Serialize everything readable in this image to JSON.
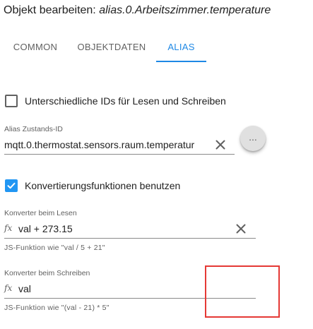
{
  "dialog": {
    "title_prefix": "Objekt bearbeiten: ",
    "object_id": "alias.0.Arbeitszimmer.temperature"
  },
  "tabs": [
    {
      "label": "COMMON",
      "active": false
    },
    {
      "label": "OBJEKTDATEN",
      "active": false
    },
    {
      "label": "ALIAS",
      "active": true
    }
  ],
  "alias": {
    "separate_ids": {
      "label": "Unterschiedliche IDs für Lesen und Schreiben",
      "checked": false
    },
    "state_id": {
      "label": "Alias Zustands-ID",
      "value": "mqtt.0.thermostat.sensors.raum.temperatur",
      "more_label": "..."
    },
    "use_conversion": {
      "label": "Konvertierungsfunktionen benutzen",
      "checked": true
    },
    "read_converter": {
      "label": "Konverter beim Lesen",
      "icon": "fx",
      "value": "val + 273.15",
      "helper": "JS-Funktion wie \"val / 5 + 21\""
    },
    "write_converter": {
      "label": "Konverter beim Schreiben",
      "icon": "fx",
      "value": "val",
      "helper": "JS-Funktion wie \"(val - 21) * 5\""
    }
  },
  "colors": {
    "accent": "#1e88e5",
    "checkbox": "#2196f3",
    "highlight": "#e53935"
  },
  "icons": {
    "clear": "close-icon",
    "function": "fx-icon",
    "check": "check-icon"
  }
}
